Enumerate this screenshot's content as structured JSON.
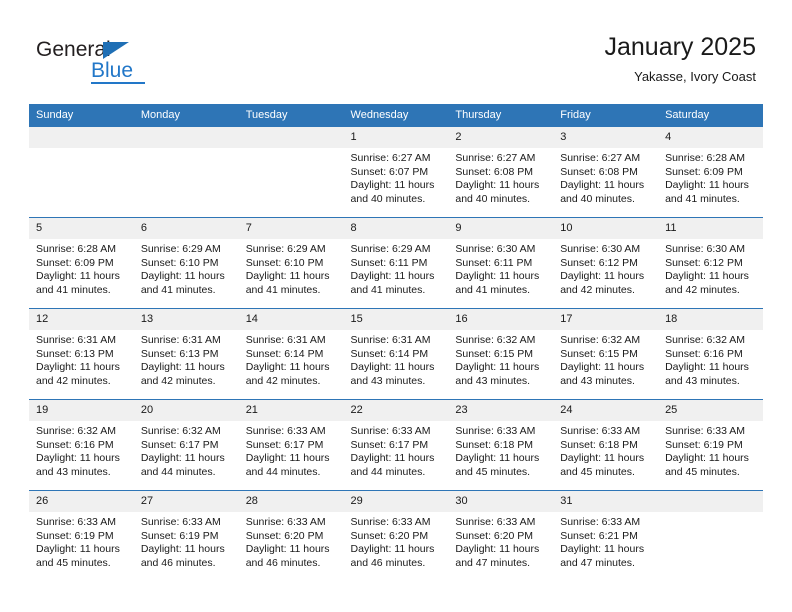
{
  "brand": {
    "name_part1": "General",
    "name_part2": "Blue",
    "accent_color": "#2277c8"
  },
  "header": {
    "title": "January 2025",
    "subtitle": "Yakasse, Ivory Coast",
    "header_bg_color": "#2e75b6",
    "daynum_bg_color": "#f0f0f0"
  },
  "weekday_headers": [
    "Sunday",
    "Monday",
    "Tuesday",
    "Wednesday",
    "Thursday",
    "Friday",
    "Saturday"
  ],
  "weeks": [
    [
      {
        "day": "",
        "sunrise": "",
        "sunset": "",
        "daylight_line1": "",
        "daylight_line2": "",
        "empty": true
      },
      {
        "day": "",
        "sunrise": "",
        "sunset": "",
        "daylight_line1": "",
        "daylight_line2": "",
        "empty": true
      },
      {
        "day": "",
        "sunrise": "",
        "sunset": "",
        "daylight_line1": "",
        "daylight_line2": "",
        "empty": true
      },
      {
        "day": "1",
        "sunrise": "Sunrise: 6:27 AM",
        "sunset": "Sunset: 6:07 PM",
        "daylight_line1": "Daylight: 11 hours",
        "daylight_line2": "and 40 minutes.",
        "empty": false
      },
      {
        "day": "2",
        "sunrise": "Sunrise: 6:27 AM",
        "sunset": "Sunset: 6:08 PM",
        "daylight_line1": "Daylight: 11 hours",
        "daylight_line2": "and 40 minutes.",
        "empty": false
      },
      {
        "day": "3",
        "sunrise": "Sunrise: 6:27 AM",
        "sunset": "Sunset: 6:08 PM",
        "daylight_line1": "Daylight: 11 hours",
        "daylight_line2": "and 40 minutes.",
        "empty": false
      },
      {
        "day": "4",
        "sunrise": "Sunrise: 6:28 AM",
        "sunset": "Sunset: 6:09 PM",
        "daylight_line1": "Daylight: 11 hours",
        "daylight_line2": "and 41 minutes.",
        "empty": false
      }
    ],
    [
      {
        "day": "5",
        "sunrise": "Sunrise: 6:28 AM",
        "sunset": "Sunset: 6:09 PM",
        "daylight_line1": "Daylight: 11 hours",
        "daylight_line2": "and 41 minutes.",
        "empty": false
      },
      {
        "day": "6",
        "sunrise": "Sunrise: 6:29 AM",
        "sunset": "Sunset: 6:10 PM",
        "daylight_line1": "Daylight: 11 hours",
        "daylight_line2": "and 41 minutes.",
        "empty": false
      },
      {
        "day": "7",
        "sunrise": "Sunrise: 6:29 AM",
        "sunset": "Sunset: 6:10 PM",
        "daylight_line1": "Daylight: 11 hours",
        "daylight_line2": "and 41 minutes.",
        "empty": false
      },
      {
        "day": "8",
        "sunrise": "Sunrise: 6:29 AM",
        "sunset": "Sunset: 6:11 PM",
        "daylight_line1": "Daylight: 11 hours",
        "daylight_line2": "and 41 minutes.",
        "empty": false
      },
      {
        "day": "9",
        "sunrise": "Sunrise: 6:30 AM",
        "sunset": "Sunset: 6:11 PM",
        "daylight_line1": "Daylight: 11 hours",
        "daylight_line2": "and 41 minutes.",
        "empty": false
      },
      {
        "day": "10",
        "sunrise": "Sunrise: 6:30 AM",
        "sunset": "Sunset: 6:12 PM",
        "daylight_line1": "Daylight: 11 hours",
        "daylight_line2": "and 42 minutes.",
        "empty": false
      },
      {
        "day": "11",
        "sunrise": "Sunrise: 6:30 AM",
        "sunset": "Sunset: 6:12 PM",
        "daylight_line1": "Daylight: 11 hours",
        "daylight_line2": "and 42 minutes.",
        "empty": false
      }
    ],
    [
      {
        "day": "12",
        "sunrise": "Sunrise: 6:31 AM",
        "sunset": "Sunset: 6:13 PM",
        "daylight_line1": "Daylight: 11 hours",
        "daylight_line2": "and 42 minutes.",
        "empty": false
      },
      {
        "day": "13",
        "sunrise": "Sunrise: 6:31 AM",
        "sunset": "Sunset: 6:13 PM",
        "daylight_line1": "Daylight: 11 hours",
        "daylight_line2": "and 42 minutes.",
        "empty": false
      },
      {
        "day": "14",
        "sunrise": "Sunrise: 6:31 AM",
        "sunset": "Sunset: 6:14 PM",
        "daylight_line1": "Daylight: 11 hours",
        "daylight_line2": "and 42 minutes.",
        "empty": false
      },
      {
        "day": "15",
        "sunrise": "Sunrise: 6:31 AM",
        "sunset": "Sunset: 6:14 PM",
        "daylight_line1": "Daylight: 11 hours",
        "daylight_line2": "and 43 minutes.",
        "empty": false
      },
      {
        "day": "16",
        "sunrise": "Sunrise: 6:32 AM",
        "sunset": "Sunset: 6:15 PM",
        "daylight_line1": "Daylight: 11 hours",
        "daylight_line2": "and 43 minutes.",
        "empty": false
      },
      {
        "day": "17",
        "sunrise": "Sunrise: 6:32 AM",
        "sunset": "Sunset: 6:15 PM",
        "daylight_line1": "Daylight: 11 hours",
        "daylight_line2": "and 43 minutes.",
        "empty": false
      },
      {
        "day": "18",
        "sunrise": "Sunrise: 6:32 AM",
        "sunset": "Sunset: 6:16 PM",
        "daylight_line1": "Daylight: 11 hours",
        "daylight_line2": "and 43 minutes.",
        "empty": false
      }
    ],
    [
      {
        "day": "19",
        "sunrise": "Sunrise: 6:32 AM",
        "sunset": "Sunset: 6:16 PM",
        "daylight_line1": "Daylight: 11 hours",
        "daylight_line2": "and 43 minutes.",
        "empty": false
      },
      {
        "day": "20",
        "sunrise": "Sunrise: 6:32 AM",
        "sunset": "Sunset: 6:17 PM",
        "daylight_line1": "Daylight: 11 hours",
        "daylight_line2": "and 44 minutes.",
        "empty": false
      },
      {
        "day": "21",
        "sunrise": "Sunrise: 6:33 AM",
        "sunset": "Sunset: 6:17 PM",
        "daylight_line1": "Daylight: 11 hours",
        "daylight_line2": "and 44 minutes.",
        "empty": false
      },
      {
        "day": "22",
        "sunrise": "Sunrise: 6:33 AM",
        "sunset": "Sunset: 6:17 PM",
        "daylight_line1": "Daylight: 11 hours",
        "daylight_line2": "and 44 minutes.",
        "empty": false
      },
      {
        "day": "23",
        "sunrise": "Sunrise: 6:33 AM",
        "sunset": "Sunset: 6:18 PM",
        "daylight_line1": "Daylight: 11 hours",
        "daylight_line2": "and 45 minutes.",
        "empty": false
      },
      {
        "day": "24",
        "sunrise": "Sunrise: 6:33 AM",
        "sunset": "Sunset: 6:18 PM",
        "daylight_line1": "Daylight: 11 hours",
        "daylight_line2": "and 45 minutes.",
        "empty": false
      },
      {
        "day": "25",
        "sunrise": "Sunrise: 6:33 AM",
        "sunset": "Sunset: 6:19 PM",
        "daylight_line1": "Daylight: 11 hours",
        "daylight_line2": "and 45 minutes.",
        "empty": false
      }
    ],
    [
      {
        "day": "26",
        "sunrise": "Sunrise: 6:33 AM",
        "sunset": "Sunset: 6:19 PM",
        "daylight_line1": "Daylight: 11 hours",
        "daylight_line2": "and 45 minutes.",
        "empty": false
      },
      {
        "day": "27",
        "sunrise": "Sunrise: 6:33 AM",
        "sunset": "Sunset: 6:19 PM",
        "daylight_line1": "Daylight: 11 hours",
        "daylight_line2": "and 46 minutes.",
        "empty": false
      },
      {
        "day": "28",
        "sunrise": "Sunrise: 6:33 AM",
        "sunset": "Sunset: 6:20 PM",
        "daylight_line1": "Daylight: 11 hours",
        "daylight_line2": "and 46 minutes.",
        "empty": false
      },
      {
        "day": "29",
        "sunrise": "Sunrise: 6:33 AM",
        "sunset": "Sunset: 6:20 PM",
        "daylight_line1": "Daylight: 11 hours",
        "daylight_line2": "and 46 minutes.",
        "empty": false
      },
      {
        "day": "30",
        "sunrise": "Sunrise: 6:33 AM",
        "sunset": "Sunset: 6:20 PM",
        "daylight_line1": "Daylight: 11 hours",
        "daylight_line2": "and 47 minutes.",
        "empty": false
      },
      {
        "day": "31",
        "sunrise": "Sunrise: 6:33 AM",
        "sunset": "Sunset: 6:21 PM",
        "daylight_line1": "Daylight: 11 hours",
        "daylight_line2": "and 47 minutes.",
        "empty": false
      },
      {
        "day": "",
        "sunrise": "",
        "sunset": "",
        "daylight_line1": "",
        "daylight_line2": "",
        "empty": true
      }
    ]
  ]
}
